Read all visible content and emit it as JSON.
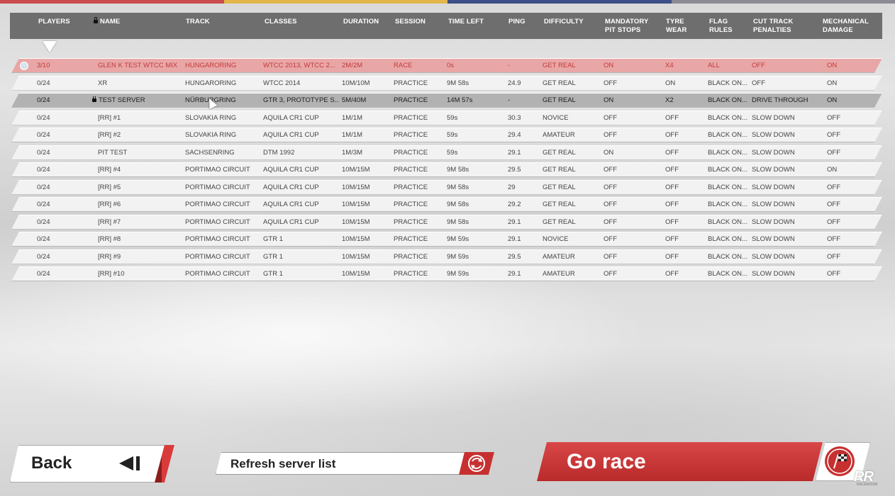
{
  "colors": {
    "top_stripe": [
      "#c94b4b",
      "#e1b64a",
      "#3c4f86",
      "#8b8b93"
    ],
    "header_bg": "#6e6e6e",
    "highlight_row": "#e9a6a6",
    "highlight_text": "#c13a3a",
    "selected_row": "#b2b2b2",
    "accent_red": "#c73030"
  },
  "columns": [
    {
      "key": "players",
      "label": "PLAYERS"
    },
    {
      "key": "name",
      "label": "NAME"
    },
    {
      "key": "track",
      "label": "TRACK"
    },
    {
      "key": "classes",
      "label": "CLASSES"
    },
    {
      "key": "duration",
      "label": "DURATION"
    },
    {
      "key": "session",
      "label": "SESSION"
    },
    {
      "key": "time_left",
      "label": "TIME LEFT"
    },
    {
      "key": "ping",
      "label": "PING"
    },
    {
      "key": "difficulty",
      "label": "DIFFICULTY"
    },
    {
      "key": "pit_stops",
      "label": "MANDATORY\nPIT STOPS"
    },
    {
      "key": "tyre_wear",
      "label": "TYRE\nWEAR"
    },
    {
      "key": "flag_rules",
      "label": "FLAG\nRULES"
    },
    {
      "key": "cut_track",
      "label": "CUT TRACK\nPENALTIES"
    },
    {
      "key": "damage",
      "label": "MECHANICAL\nDAMAGE"
    }
  ],
  "servers": [
    {
      "state": "highlight",
      "locked": false,
      "players": "3/10",
      "name": "GLEN K TEST WTCC MIX",
      "track": "HUNGARORING",
      "classes": "WTCC 2013, WTCC 2...",
      "duration": "2M/2M",
      "session": "RACE",
      "time_left": "0s",
      "ping": "-",
      "difficulty": "GET REAL",
      "pit_stops": "ON",
      "tyre_wear": "X4",
      "flag_rules": "ALL",
      "cut_track": "OFF",
      "damage": "ON"
    },
    {
      "state": "normal",
      "locked": false,
      "players": "0/24",
      "name": "XR",
      "track": "HUNGARORING",
      "classes": "WTCC 2014",
      "duration": "10M/10M",
      "session": "PRACTICE",
      "time_left": "9M 58s",
      "ping": "24.9",
      "difficulty": "GET REAL",
      "pit_stops": "OFF",
      "tyre_wear": "ON",
      "flag_rules": "BLACK ON...",
      "cut_track": "OFF",
      "damage": "ON"
    },
    {
      "state": "selected",
      "locked": true,
      "players": "0/24",
      "name": "TEST SERVER",
      "track": "NÜRBURGRING",
      "classes": "GTR 3, PROTOTYPE S...",
      "duration": "5M/40M",
      "session": "PRACTICE",
      "time_left": "14M 57s",
      "ping": "-",
      "difficulty": "GET REAL",
      "pit_stops": "ON",
      "tyre_wear": "X2",
      "flag_rules": "BLACK ON...",
      "cut_track": "DRIVE THROUGH",
      "damage": "ON"
    },
    {
      "state": "normal",
      "locked": false,
      "players": "0/24",
      "name": "[RR] #1",
      "track": "SLOVAKIA RING",
      "classes": "AQUILA CR1 CUP",
      "duration": "1M/1M",
      "session": "PRACTICE",
      "time_left": "59s",
      "ping": "30.3",
      "difficulty": "NOVICE",
      "pit_stops": "OFF",
      "tyre_wear": "OFF",
      "flag_rules": "BLACK ON...",
      "cut_track": "SLOW DOWN",
      "damage": "OFF"
    },
    {
      "state": "normal",
      "locked": false,
      "players": "0/24",
      "name": "[RR] #2",
      "track": "SLOVAKIA RING",
      "classes": "AQUILA CR1 CUP",
      "duration": "1M/1M",
      "session": "PRACTICE",
      "time_left": "59s",
      "ping": "29.4",
      "difficulty": "AMATEUR",
      "pit_stops": "OFF",
      "tyre_wear": "OFF",
      "flag_rules": "BLACK ON...",
      "cut_track": "SLOW DOWN",
      "damage": "OFF"
    },
    {
      "state": "normal",
      "locked": false,
      "players": "0/24",
      "name": "PIT TEST",
      "track": "SACHSENRING",
      "classes": "DTM 1992",
      "duration": "1M/3M",
      "session": "PRACTICE",
      "time_left": "59s",
      "ping": "29.1",
      "difficulty": "GET REAL",
      "pit_stops": "ON",
      "tyre_wear": "OFF",
      "flag_rules": "BLACK ON...",
      "cut_track": "SLOW DOWN",
      "damage": "OFF"
    },
    {
      "state": "normal",
      "locked": false,
      "players": "0/24",
      "name": "[RR] #4",
      "track": "PORTIMAO CIRCUIT",
      "classes": "AQUILA CR1 CUP",
      "duration": "10M/15M",
      "session": "PRACTICE",
      "time_left": "9M 58s",
      "ping": "29.5",
      "difficulty": "GET REAL",
      "pit_stops": "OFF",
      "tyre_wear": "OFF",
      "flag_rules": "BLACK ON...",
      "cut_track": "SLOW DOWN",
      "damage": "ON"
    },
    {
      "state": "normal",
      "locked": false,
      "players": "0/24",
      "name": "[RR] #5",
      "track": "PORTIMAO CIRCUIT",
      "classes": "AQUILA CR1 CUP",
      "duration": "10M/15M",
      "session": "PRACTICE",
      "time_left": "9M 58s",
      "ping": "29",
      "difficulty": "GET REAL",
      "pit_stops": "OFF",
      "tyre_wear": "OFF",
      "flag_rules": "BLACK ON...",
      "cut_track": "SLOW DOWN",
      "damage": "OFF"
    },
    {
      "state": "normal",
      "locked": false,
      "players": "0/24",
      "name": "[RR] #6",
      "track": "PORTIMAO CIRCUIT",
      "classes": "AQUILA CR1 CUP",
      "duration": "10M/15M",
      "session": "PRACTICE",
      "time_left": "9M 58s",
      "ping": "29.2",
      "difficulty": "GET REAL",
      "pit_stops": "OFF",
      "tyre_wear": "OFF",
      "flag_rules": "BLACK ON...",
      "cut_track": "SLOW DOWN",
      "damage": "OFF"
    },
    {
      "state": "normal",
      "locked": false,
      "players": "0/24",
      "name": "[RR] #7",
      "track": "PORTIMAO CIRCUIT",
      "classes": "AQUILA CR1 CUP",
      "duration": "10M/15M",
      "session": "PRACTICE",
      "time_left": "9M 58s",
      "ping": "29.1",
      "difficulty": "GET REAL",
      "pit_stops": "OFF",
      "tyre_wear": "OFF",
      "flag_rules": "BLACK ON...",
      "cut_track": "SLOW DOWN",
      "damage": "OFF"
    },
    {
      "state": "normal",
      "locked": false,
      "players": "0/24",
      "name": "[RR] #8",
      "track": "PORTIMAO CIRCUIT",
      "classes": "GTR 1",
      "duration": "10M/15M",
      "session": "PRACTICE",
      "time_left": "9M 59s",
      "ping": "29.1",
      "difficulty": "NOVICE",
      "pit_stops": "OFF",
      "tyre_wear": "OFF",
      "flag_rules": "BLACK ON...",
      "cut_track": "SLOW DOWN",
      "damage": "OFF"
    },
    {
      "state": "normal",
      "locked": false,
      "players": "0/24",
      "name": "[RR] #9",
      "track": "PORTIMAO CIRCUIT",
      "classes": "GTR 1",
      "duration": "10M/15M",
      "session": "PRACTICE",
      "time_left": "9M 59s",
      "ping": "29.5",
      "difficulty": "AMATEUR",
      "pit_stops": "OFF",
      "tyre_wear": "OFF",
      "flag_rules": "BLACK ON...",
      "cut_track": "SLOW DOWN",
      "damage": "OFF"
    },
    {
      "state": "normal",
      "locked": false,
      "players": "0/24",
      "name": "[RR] #10",
      "track": "PORTIMAO CIRCUIT",
      "classes": "GTR 1",
      "duration": "10M/15M",
      "session": "PRACTICE",
      "time_left": "9M 59s",
      "ping": "29.1",
      "difficulty": "AMATEUR",
      "pit_stops": "OFF",
      "tyre_wear": "OFF",
      "flag_rules": "BLACK ON...",
      "cut_track": "SLOW DOWN",
      "damage": "OFF"
    }
  ],
  "buttons": {
    "back": {
      "label": "Back",
      "icon": "back-arrow-icon"
    },
    "refresh": {
      "label": "Refresh server list",
      "icon": "refresh-icon"
    },
    "go": {
      "label": "Go race",
      "icon": "checkered-flag-icon"
    }
  },
  "logo": {
    "main": "RR",
    "sub": "RACEROOM"
  }
}
